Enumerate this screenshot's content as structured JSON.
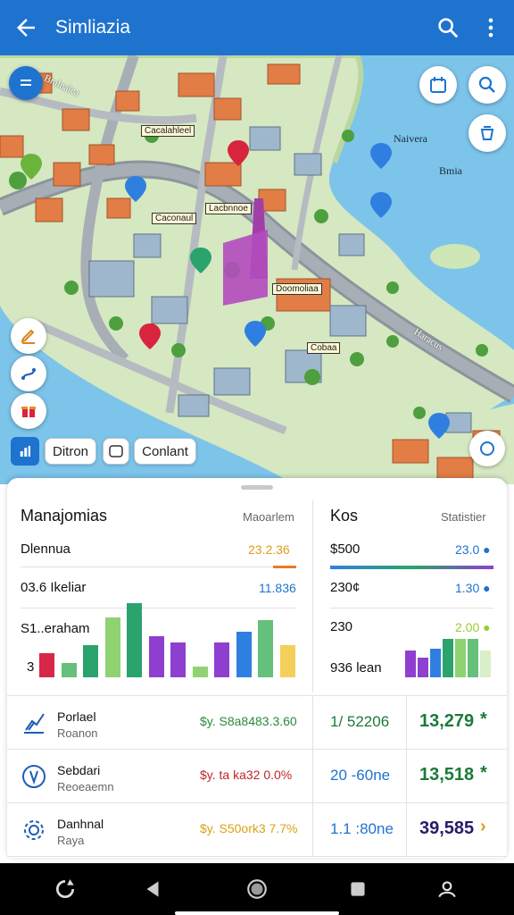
{
  "appbar": {
    "title": "Simliazia",
    "bg": "#1e73cf"
  },
  "map": {
    "labels": {
      "harbor": "Naivera",
      "island": "Bmia"
    },
    "tags": [
      "Cacalahleel",
      "Caconaul",
      "Lacbnnoe",
      "Doomoliaa",
      "Cobaa"
    ],
    "streets": [
      "Bralnalca",
      "Haracus"
    ]
  },
  "chips": {
    "chip1": "Ditron",
    "chip2": "Conlant"
  },
  "sheet": {
    "left": {
      "title": "Manajomias",
      "subtitle": "Maoarlem",
      "rows": [
        {
          "label": "Dlennua",
          "value": "23.2.36",
          "color": "#e09a1a"
        },
        {
          "label": "03.6 Ikeliar",
          "value": "11.836",
          "color": "#1e73cf"
        },
        {
          "label": "S1..eraham",
          "value": ""
        },
        {
          "label": "3",
          "value": ""
        }
      ],
      "chart_data": {
        "type": "bar",
        "values": [
          26,
          15,
          35,
          65,
          80,
          44,
          38,
          12,
          38,
          49,
          62,
          35
        ],
        "colors": [
          "#d8264a",
          "#64c07a",
          "#2aa36c",
          "#8fd272",
          "#2aa36c",
          "#8e3fd0",
          "#8e3fd0",
          "#8fd272",
          "#8e3fd0",
          "#2f7fe0",
          "#64c07a",
          "#f4cf5a"
        ]
      }
    },
    "right": {
      "title": "Kos",
      "subtitle": "Statistier",
      "rows": [
        {
          "label": "$500",
          "value": "23.0 ●",
          "color": "#1e73cf"
        },
        {
          "label": "230¢",
          "value": "1.30 ●",
          "color": "#1e73cf"
        },
        {
          "label": "230",
          "value": "2.00 ●",
          "color": "#9acd32"
        },
        {
          "label": "936 lean",
          "value": ""
        }
      ],
      "chart_data": {
        "type": "bar",
        "values": [
          28,
          20,
          30,
          40,
          40,
          40,
          28
        ],
        "colors": [
          "#8e3fd0",
          "#8e3fd0",
          "#2f7fe0",
          "#2aa36c",
          "#8fd272",
          "#64c07a",
          "#d9efc9"
        ]
      }
    },
    "list": [
      {
        "title": "Porlael",
        "subtitle": "Roanon",
        "amount": "$y. S8a8483.3.60",
        "amount_color": "#2a8a3a",
        "col2": "1/ 52206",
        "col2_color": "#1c7a3a",
        "col3": "13,279",
        "col3_suffix": "*",
        "col3_color": "#1c7a3a",
        "icon": "chart-line-icon"
      },
      {
        "title": "Sebdari",
        "subtitle": "Reoeaemn",
        "amount": "$y. ta ka32 0.0%",
        "amount_color": "#c0262a",
        "col2": "20 -60ne",
        "col2_color": "#1e73cf",
        "col3": "13,518",
        "col3_suffix": "*",
        "col3_color": "#1c7a3a",
        "icon": "gauge-icon"
      },
      {
        "title": "Danhnal",
        "subtitle": "Raya",
        "amount": "$y. S50ork3 7.7%",
        "amount_color": "#d9a216",
        "col2": "1.1 :80ne",
        "col2_color": "#1e73cf",
        "col3": "39,585",
        "col3_suffix": "›",
        "col3_color": "#2a1a6a",
        "icon": "gear-network-icon"
      }
    ]
  }
}
